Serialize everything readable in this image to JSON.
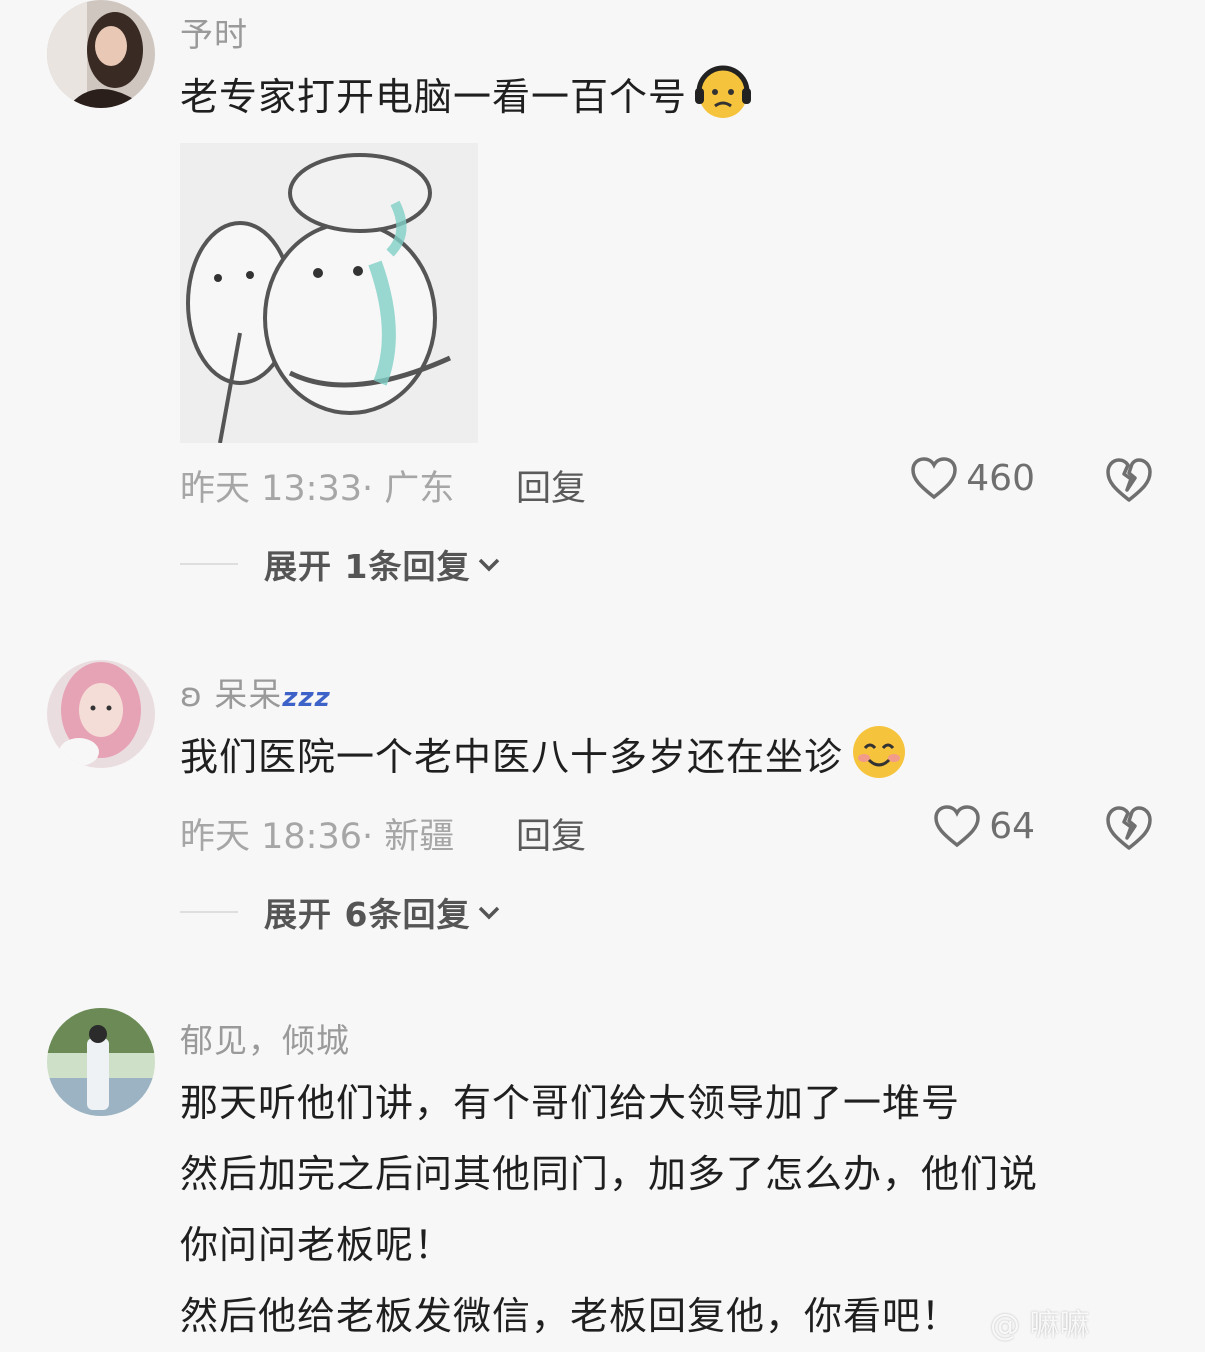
{
  "comments": [
    {
      "username": "予时",
      "lines": [
        "老专家打开电脑一看一百个号"
      ],
      "emoji": "worried-headphones-emoji",
      "sticker": "hugging-crying-cartoon-sticker",
      "time": "昨天 13:33",
      "location": "· 广东",
      "reply_label": "回复",
      "likes": "460",
      "expand_label": "展开 1条回复"
    },
    {
      "username": "ʚ 呆呆",
      "username_suffix": "zzz",
      "lines": [
        "我们医院一个老中医八十多岁还在坐诊"
      ],
      "emoji": "smiling-blush-emoji",
      "time": "昨天 18:36",
      "location": "· 新疆",
      "reply_label": "回复",
      "likes": "64",
      "expand_label": "展开 6条回复"
    },
    {
      "username": "郁见，倾城",
      "lines": [
        "那天听他们讲，有个哥们给大领导加了一堆号",
        "然后加完之后问其他同门，加多了怎么办，他们说",
        "你问问老板呢！",
        "然后他给老板发微信，老板回复他，你看吧！"
      ]
    }
  ],
  "watermark": "@ 嘛嘛",
  "colors": {
    "background": "#f7f7f7",
    "text": "#1f1f1f",
    "meta": "#a6a6a6"
  }
}
